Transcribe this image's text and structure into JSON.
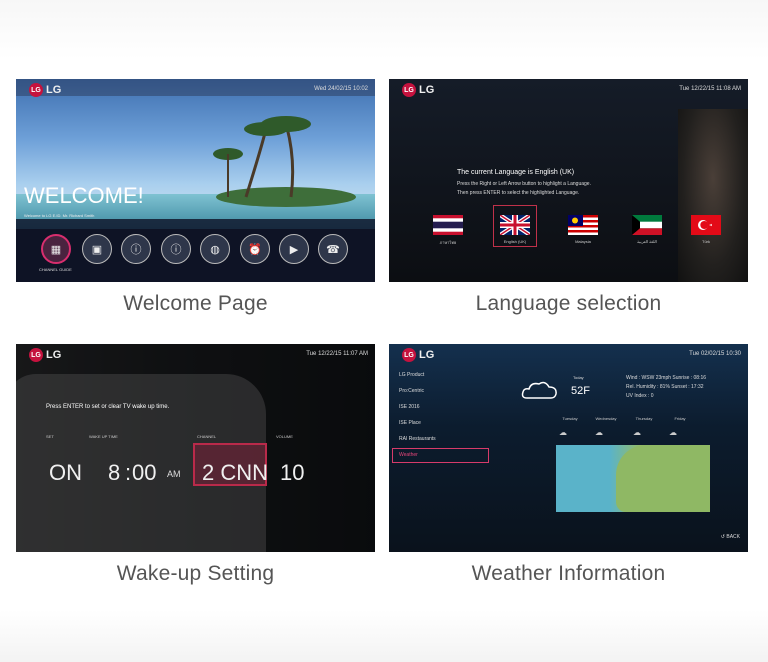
{
  "panels": [
    {
      "caption": "Welcome Page",
      "logo": "LG",
      "date": "Wed 24/02/15 10:02",
      "welcome": "WELCOME!",
      "welcome_sub": "Welcome to LG E.ID. Mr. Richard Smith",
      "active_label": "CHANNEL GUIDE",
      "icons": [
        "channel-guide-icon",
        "briefcase-icon",
        "info-icon",
        "info-icon",
        "globe-icon",
        "alarm-clock-icon",
        "media-icon",
        "phone-icon"
      ]
    },
    {
      "caption": "Language selection",
      "logo": "LG",
      "date": "Tue 12/22/15 11:08 AM",
      "title": "The current Language is English (UK)",
      "line1": "Press the Right or Left Arrow button to highlight a Language.",
      "line2": "Then press ENTER to select the highlighted Language.",
      "flags": [
        {
          "label": "ภาษาไทย"
        },
        {
          "label": "English (UK)"
        },
        {
          "label": "Malaysia"
        },
        {
          "label": "اللغة العربية"
        },
        {
          "label": "Türk"
        }
      ]
    },
    {
      "caption": "Wake-up Setting",
      "logo": "LG",
      "date": "Tue 12/22/15 11:07 AM",
      "instruction": "Press ENTER to set or clear TV wake up time.",
      "labels": {
        "set": "SET",
        "wake": "WAKE UP TIME",
        "channel": "CHANNEL",
        "volume": "VOLUME"
      },
      "values": {
        "set": "ON",
        "hour": "8",
        "minute": "00",
        "ampm": "AM",
        "channel": "2 CNN",
        "volume": "10"
      }
    },
    {
      "caption": "Weather Information",
      "logo": "LG",
      "date": "Tue 02/02/15 10:30",
      "menu": [
        "LG Product",
        "Pro:Centric",
        "ISE 2016",
        "ISE Place",
        "RAI Restaurants",
        "Weather"
      ],
      "today": "Today",
      "temp": "52F",
      "wind": "Wind : WSW 23mph  Sunrise : 08:16",
      "humidity": "Rel. Humidity : 81%   Sunset : 17:32",
      "uv": "UV Index : 0",
      "days": [
        "Tuesday",
        "Wednesday",
        "Thursday",
        "Friday"
      ],
      "back": "BACK"
    }
  ]
}
